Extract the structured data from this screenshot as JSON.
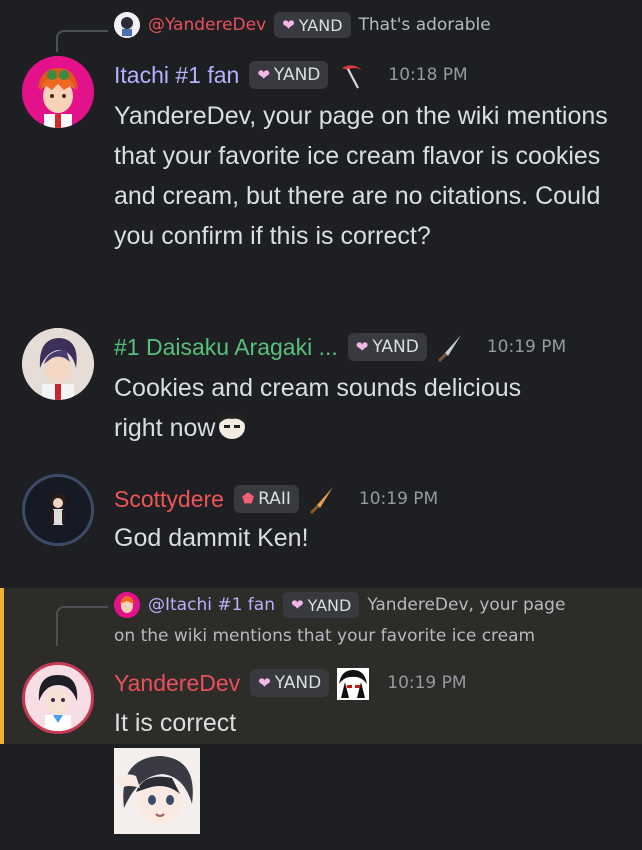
{
  "messages": [
    {
      "reply": {
        "author": "@YandereDev",
        "tag": "YAND",
        "text": "That's adorable",
        "author_color": "#e8505b"
      },
      "author": "Itachi #1 fan",
      "author_color": "#b9b0ff",
      "tag": "YAND",
      "time": "10:18 PM",
      "text": "YandereDev, your page on the wiki mentions that your favorite ice cream flavor is cookies and cream, but there are no citations. Could you confirm if this is correct?"
    },
    {
      "author": "#1 Daisaku Aragaki ...",
      "author_color": "#57c17b",
      "tag": "YAND",
      "time": "10:19 PM",
      "text": "Cookies and cream sounds delicious right now"
    },
    {
      "author": "Scottydere",
      "author_color": "#f05454",
      "tag": "RAII",
      "time": "10:19 PM",
      "text": "God dammit Ken!"
    },
    {
      "reply": {
        "author": "@Itachi #1 fan",
        "tag": "YAND",
        "text_line1": "YandereDev, your page",
        "text_line2": "on the wiki mentions that your favorite ice cream",
        "author_color": "#b9b0ff"
      },
      "author": "YandereDev",
      "author_color": "#e8505b",
      "tag": "YAND",
      "time": "10:19 PM",
      "text": "It is correct"
    }
  ],
  "icons": {
    "tag_yand": "heart-icon",
    "tag_raii": "gem-icon",
    "role_itachi": "scythe-icon",
    "role_daisaku": "knife-icon",
    "role_scottydere": "knife-icon",
    "role_yandere": "anime-face-icon"
  }
}
